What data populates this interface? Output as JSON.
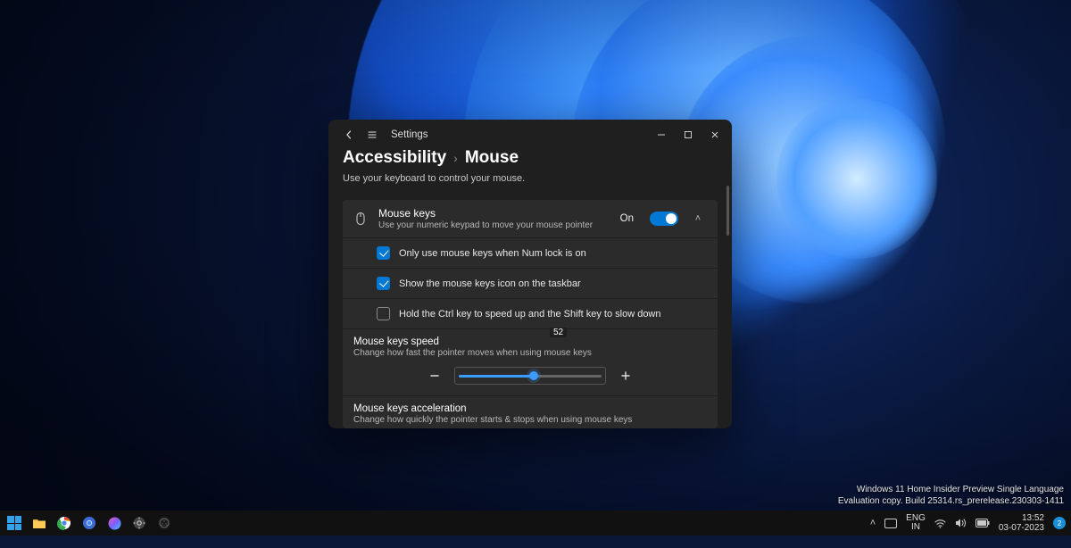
{
  "window": {
    "app_title": "Settings",
    "breadcrumb": {
      "parent": "Accessibility",
      "current": "Mouse"
    },
    "subtitle": "Use your keyboard to control your mouse."
  },
  "mousekeys": {
    "title": "Mouse keys",
    "desc": "Use your numeric keypad to move your mouse pointer",
    "state_label": "On",
    "enabled": true,
    "options": {
      "numlock": {
        "label": "Only use mouse keys when Num lock is on",
        "checked": true
      },
      "taskbar": {
        "label": "Show the mouse keys icon on the taskbar",
        "checked": true
      },
      "ctrlshift": {
        "label": "Hold the Ctrl key to speed up and the Shift key to slow down",
        "checked": false
      }
    }
  },
  "speed": {
    "title": "Mouse keys speed",
    "desc": "Change how fast the pointer moves when using mouse keys",
    "value": 52,
    "min": 0,
    "max": 100
  },
  "accel": {
    "title": "Mouse keys acceleration",
    "desc": "Change how quickly the pointer starts & stops when using mouse keys"
  },
  "watermark": {
    "line1": "Windows 11 Home Insider Preview Single Language",
    "line2": "Evaluation copy. Build 25314.rs_prerelease.230303-1411"
  },
  "taskbar": {
    "lang": {
      "top": "ENG",
      "bottom": "IN"
    },
    "clock": {
      "time": "13:52",
      "date": "03-07-2023"
    },
    "notif_count": "2"
  }
}
